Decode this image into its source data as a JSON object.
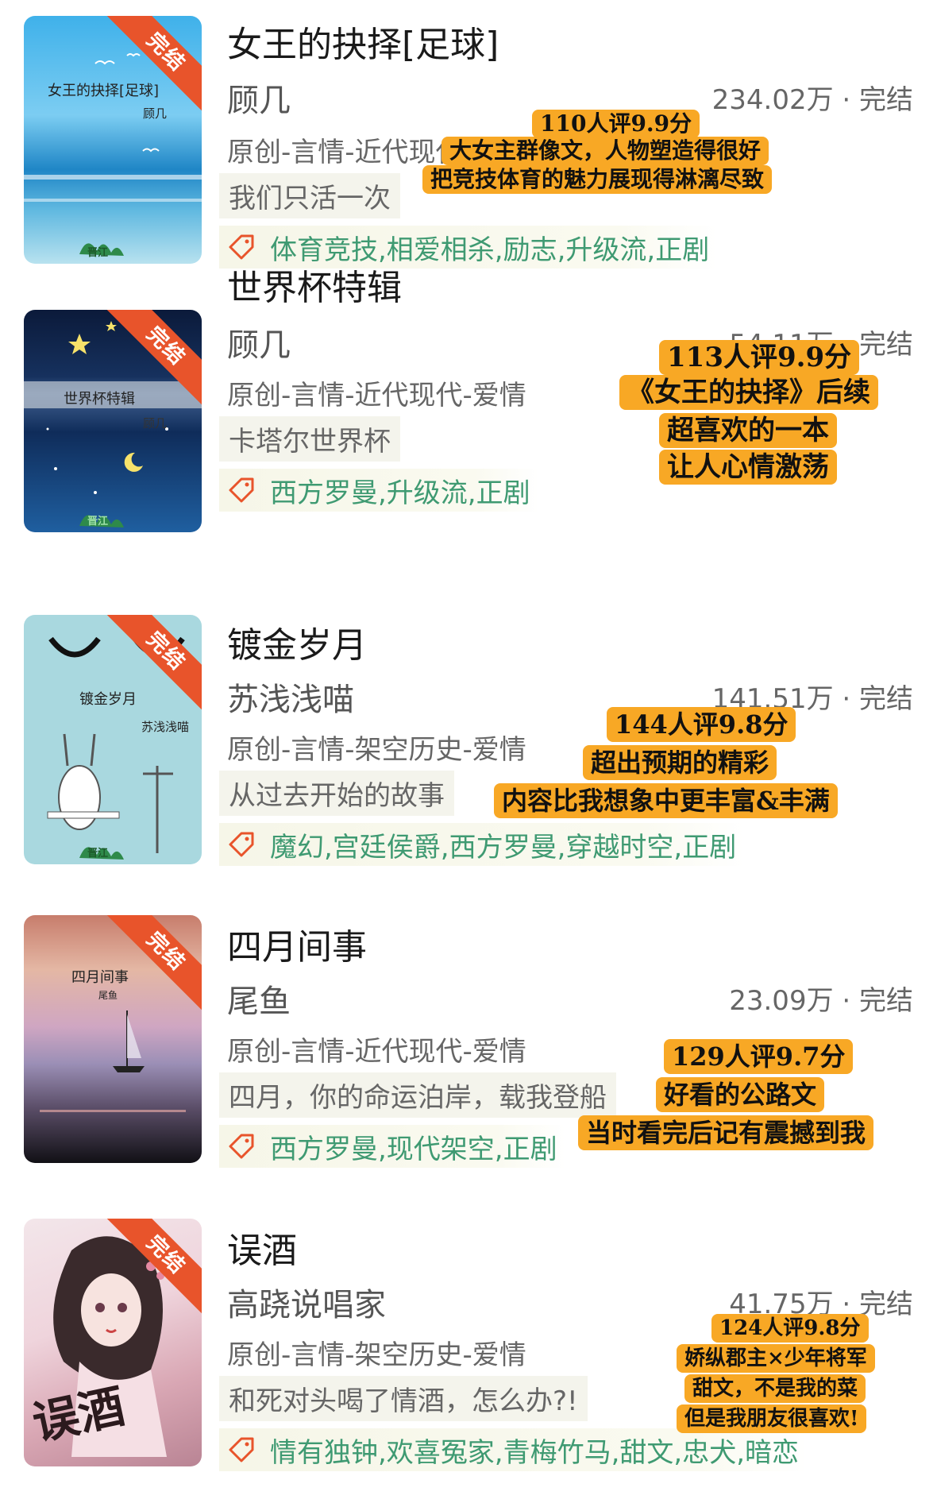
{
  "books": [
    {
      "title": "女王的抉择[足球]",
      "author": "顾几",
      "stats": "234.02万 · 完结",
      "category": "原创-言情-近代现代-爱情",
      "summary": "我们只活一次",
      "tags": "体育竞技,相爱相杀,励志,升级流,正剧",
      "cover": {
        "title": "女王的抉择[足球]",
        "author": "顾几",
        "badge": "完结",
        "logo": "晋江"
      },
      "notes": [
        "110人评9.9分",
        "大女主群像文，人物塑造得很好",
        "把竞技体育的魅力展现得淋漓尽致"
      ]
    },
    {
      "title": "世界杯特辑",
      "author": "顾几",
      "stats": "54.11万 · 完结",
      "category": "原创-言情-近代现代-爱情",
      "summary": "卡塔尔世界杯",
      "tags": "西方罗曼,升级流,正剧",
      "cover": {
        "title": "世界杯特辑",
        "author": "顾几",
        "badge": "完结",
        "logo": "晋江"
      },
      "notes": [
        "113人评9.9分",
        "《女王的抉择》后续",
        "超喜欢的一本",
        "让人心情激荡"
      ]
    },
    {
      "title": "镀金岁月",
      "author": "苏浅浅喵",
      "stats": "141.51万 · 完结",
      "category": "原创-言情-架空历史-爱情",
      "summary": "从过去开始的故事",
      "tags": "魔幻,宫廷侯爵,西方罗曼,穿越时空,正剧",
      "cover": {
        "title": "镀金岁月",
        "author": "苏浅浅喵",
        "badge": "完结",
        "logo": "晋江"
      },
      "notes": [
        "144人评9.8分",
        "超出预期的精彩",
        "内容比我想象中更丰富&丰满"
      ]
    },
    {
      "title": "四月间事",
      "author": "尾鱼",
      "stats": "23.09万 · 完结",
      "category": "原创-言情-近代现代-爱情",
      "summary": "四月，你的命运泊岸，载我登船",
      "tags": "西方罗曼,现代架空,正剧",
      "cover": {
        "title": "四月间事",
        "author": "尾鱼",
        "badge": "完结",
        "logo": ""
      },
      "notes": [
        "129人评9.7分",
        "好看的公路文",
        "当时看完后记有震撼到我"
      ]
    },
    {
      "title": "误酒",
      "author": "高跷说唱家",
      "stats": "41.75万 · 完结",
      "category": "原创-言情-架空历史-爱情",
      "summary": "和死对头喝了情酒，怎么办?!",
      "tags": "情有独钟,欢喜冤家,青梅竹马,甜文,忠犬,暗恋",
      "cover": {
        "title": "误酒",
        "author": "",
        "badge": "完结",
        "logo": ""
      },
      "notes": [
        "124人评9.8分",
        "娇纵郡主×少年将军",
        "甜文，不是我的菜",
        "但是我朋友很喜欢!"
      ]
    }
  ],
  "colors": {
    "badge": "#e8542b",
    "tag_text": "#3f9a72",
    "note_bg": "#f8a825"
  },
  "icons": {
    "tag": "tag-icon"
  }
}
